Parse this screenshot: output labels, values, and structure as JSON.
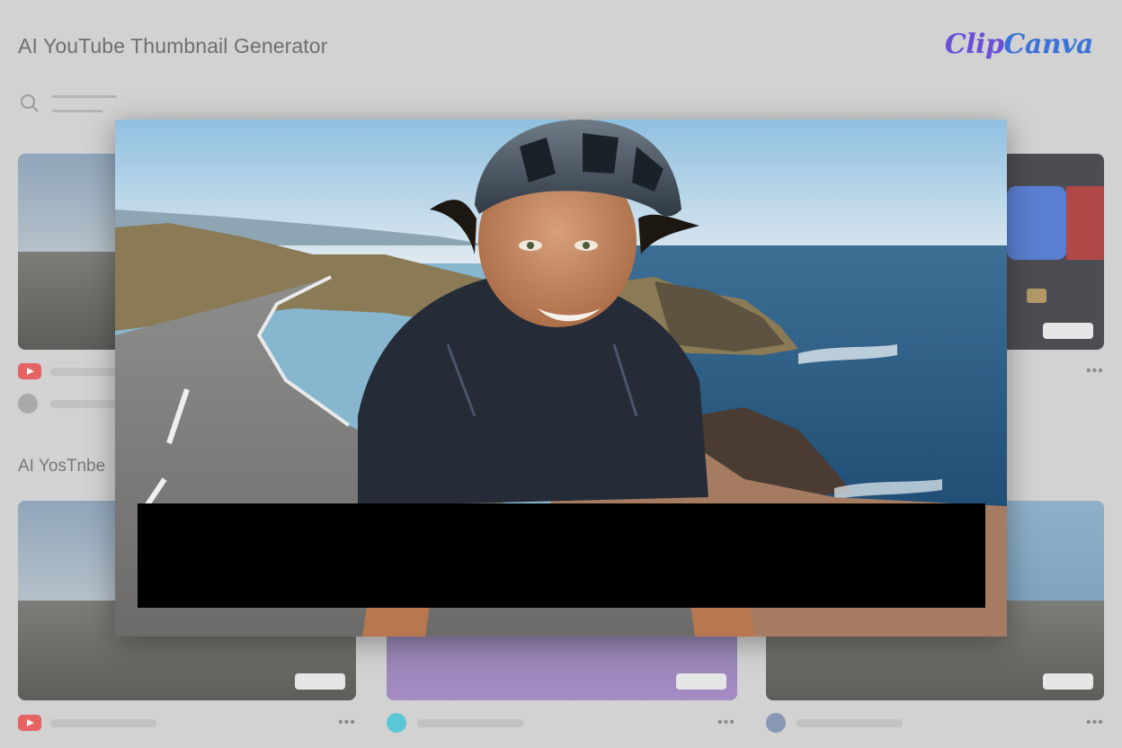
{
  "header": {
    "title": "AI YouTube Thumbnail Generator",
    "brand_part1": "Clip",
    "brand_part2": "Canva"
  },
  "section": {
    "title": "AI YosTnbe"
  },
  "icons": {
    "search": "search-icon",
    "youtube": "youtube-icon",
    "more": "more-icon"
  },
  "colors": {
    "brand_purple": "#6b4fd8",
    "brand_blue": "#3b74d9",
    "youtube_red": "#e56363",
    "redaction": "#000000"
  },
  "more_glyph": "•••"
}
